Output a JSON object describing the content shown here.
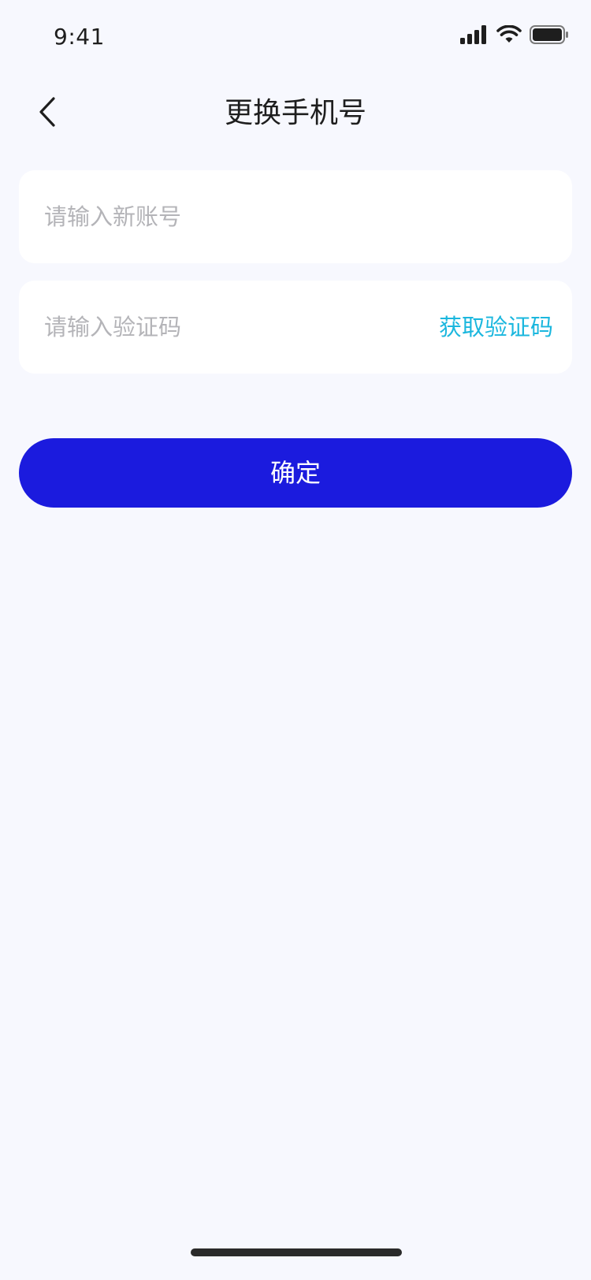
{
  "status_bar": {
    "time": "9:41",
    "icons": [
      "signal-icon",
      "wifi-icon",
      "battery-icon"
    ]
  },
  "header": {
    "back_icon": "chevron-left-icon",
    "title": "更换手机号"
  },
  "form": {
    "account_placeholder": "请输入新账号",
    "account_value": "",
    "code_placeholder": "请输入验证码",
    "code_value": "",
    "get_code_label": "获取验证码"
  },
  "confirm_label": "确定",
  "colors": {
    "background": "#F7F8FE",
    "primary": "#1B1BDE",
    "link": "#1BB7DE",
    "placeholder": "#B4B4B8"
  }
}
